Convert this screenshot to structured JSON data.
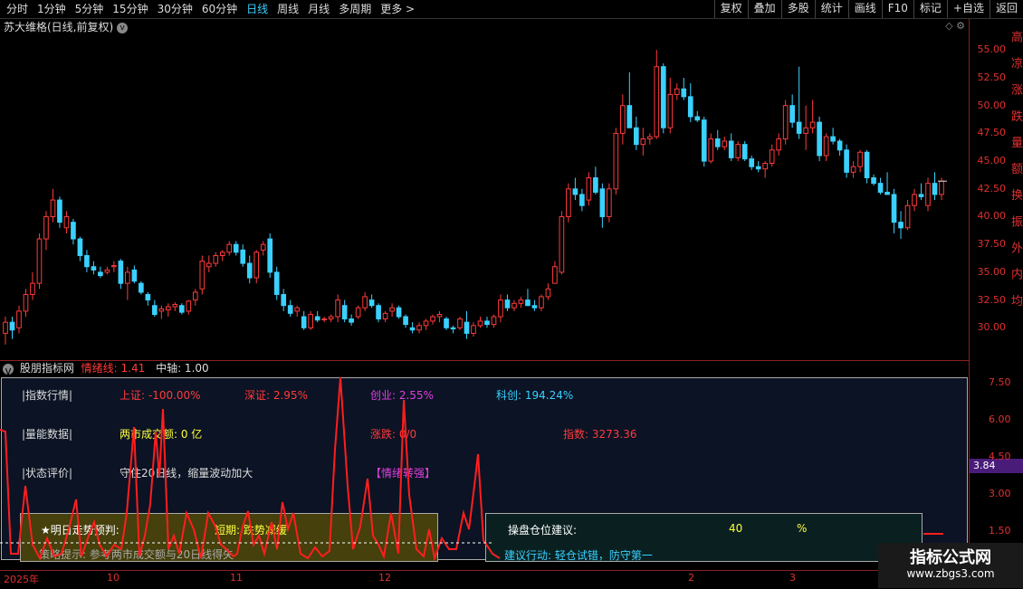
{
  "toolbar": {
    "periods": [
      "分时",
      "1分钟",
      "5分钟",
      "15分钟",
      "30分钟",
      "60分钟",
      "日线",
      "周线",
      "月线",
      "多周期",
      "更多 >"
    ],
    "active_index": 6,
    "right_buttons": [
      "复权",
      "叠加",
      "多股",
      "统计",
      "画线",
      "F10",
      "标记",
      "+自选",
      "返回"
    ]
  },
  "stock": {
    "title": "苏大维格(日线,前复权)",
    "chevron": "v",
    "right_icons": "◇ ⚙"
  },
  "price_axis": [
    "55.00",
    "52.50",
    "50.00",
    "47.50",
    "45.00",
    "42.50",
    "40.00",
    "37.50",
    "35.00",
    "32.50",
    "30.00"
  ],
  "right_strip_text": "高 凉 涨 跌 量 额 换 振 外 内 均",
  "indicator": {
    "name": "股朋指标网",
    "line_label": "情绪线: 1.41",
    "axis_label": "中轴: 1.00"
  },
  "info": {
    "row1_label": "|指数行情|",
    "sh": "上证: -100.00%",
    "sz": "深证: 2.95%",
    "cyb": "创业: 2.55%",
    "kc": "科创: 194.24%",
    "row2_label": "|量能数据|",
    "turnover": "两市成交额: 0 亿",
    "updown": "涨跌: 0/0",
    "index": "指数: 3273.36",
    "row3_label": "|状态评价|",
    "status": "守住20日线，缩量波动加大",
    "mood": "【情绪转强】",
    "forecast_label": "★明日走势预判:",
    "forecast_value": "短期: 跌势减缓",
    "tip": "策略提示: 参考两市成交额与20日线得失",
    "position_label": "操盘仓位建议:",
    "position_value": "40",
    "position_unit": "%",
    "action": "建议行动: 轻仓试错，防守第一"
  },
  "sub_axis": [
    "7.50",
    "6.00",
    "4.50",
    "3.00",
    "1.50"
  ],
  "sub_badge": "3.84",
  "date_axis": [
    "2025年",
    "10",
    "11",
    "12",
    "2",
    "3"
  ],
  "watermark": {
    "line1": "指标公式网",
    "line2": "www.zbgs3.com"
  },
  "colors": {
    "up": "#ff3b3b",
    "down": "#3ad1ff",
    "line": "#ff1e1e"
  },
  "chart_data": {
    "type": "candlestick",
    "title": "苏大维格(日线,前复权)",
    "ylim": [
      27.5,
      56.0
    ],
    "candles": [
      [
        29.5,
        31.0,
        28.5,
        30.5
      ],
      [
        30.5,
        31.0,
        29.0,
        29.8
      ],
      [
        30.0,
        32.0,
        29.5,
        31.5
      ],
      [
        31.5,
        33.5,
        31.0,
        33.0
      ],
      [
        33.0,
        35.0,
        32.5,
        34.0
      ],
      [
        34.0,
        38.5,
        33.5,
        38.0
      ],
      [
        38.0,
        40.5,
        37.0,
        40.0
      ],
      [
        40.0,
        42.5,
        39.5,
        41.5
      ],
      [
        41.5,
        41.8,
        39.0,
        39.5
      ],
      [
        39.0,
        40.5,
        38.5,
        40.0
      ],
      [
        39.5,
        39.8,
        37.5,
        38.0
      ],
      [
        38.0,
        38.2,
        36.0,
        36.5
      ],
      [
        36.5,
        37.0,
        35.0,
        35.5
      ],
      [
        35.5,
        36.0,
        34.8,
        35.2
      ],
      [
        35.0,
        35.5,
        34.5,
        34.7
      ],
      [
        35.0,
        35.5,
        34.8,
        35.2
      ],
      [
        35.5,
        36.0,
        35.0,
        35.6
      ],
      [
        36.0,
        36.2,
        33.5,
        34.0
      ],
      [
        34.0,
        35.5,
        32.5,
        35.0
      ],
      [
        35.2,
        35.6,
        34.0,
        34.2
      ],
      [
        34.0,
        34.2,
        33.0,
        33.2
      ],
      [
        33.0,
        33.2,
        32.0,
        32.5
      ],
      [
        32.0,
        32.5,
        31.0,
        31.2
      ],
      [
        31.5,
        32.0,
        30.8,
        31.7
      ],
      [
        31.6,
        32.2,
        31.0,
        31.9
      ],
      [
        31.9,
        32.3,
        31.5,
        32.1
      ],
      [
        32.0,
        32.2,
        31.2,
        31.4
      ],
      [
        31.5,
        32.5,
        31.2,
        32.4
      ],
      [
        32.5,
        33.5,
        32.0,
        33.2
      ],
      [
        33.5,
        36.5,
        33.0,
        36.0
      ],
      [
        35.5,
        36.5,
        35.0,
        35.8
      ],
      [
        35.8,
        36.8,
        35.5,
        36.5
      ],
      [
        36.5,
        37.0,
        36.0,
        36.8
      ],
      [
        36.8,
        37.8,
        36.5,
        37.5
      ],
      [
        37.5,
        37.8,
        36.5,
        36.8
      ],
      [
        37.0,
        37.5,
        35.5,
        35.8
      ],
      [
        35.8,
        36.5,
        34.0,
        34.5
      ],
      [
        34.5,
        37.0,
        34.0,
        36.8
      ],
      [
        37.0,
        37.8,
        36.5,
        37.5
      ],
      [
        38.0,
        38.5,
        34.5,
        35.0
      ],
      [
        35.0,
        35.5,
        32.5,
        33.0
      ],
      [
        33.0,
        33.5,
        31.5,
        32.0
      ],
      [
        32.0,
        32.5,
        31.0,
        31.3
      ],
      [
        31.5,
        32.0,
        31.0,
        31.8
      ],
      [
        31.0,
        31.5,
        29.8,
        30.0
      ],
      [
        30.0,
        31.5,
        29.8,
        31.2
      ],
      [
        31.0,
        31.5,
        30.5,
        30.7
      ],
      [
        30.8,
        31.0,
        30.5,
        30.8
      ],
      [
        30.8,
        31.2,
        30.5,
        31.0
      ],
      [
        31.0,
        33.0,
        30.5,
        32.5
      ],
      [
        32.0,
        32.5,
        30.5,
        30.8
      ],
      [
        30.8,
        31.2,
        30.2,
        30.5
      ],
      [
        31.0,
        32.0,
        30.8,
        31.8
      ],
      [
        31.8,
        33.2,
        31.5,
        32.8
      ],
      [
        32.5,
        33.0,
        31.8,
        32.0
      ],
      [
        32.0,
        32.2,
        30.5,
        30.8
      ],
      [
        30.8,
        31.5,
        30.5,
        31.3
      ],
      [
        31.5,
        32.2,
        31.0,
        31.8
      ],
      [
        31.8,
        32.0,
        30.8,
        31.0
      ],
      [
        31.0,
        31.2,
        30.0,
        30.3
      ],
      [
        30.0,
        30.5,
        29.5,
        29.8
      ],
      [
        29.8,
        30.5,
        29.5,
        30.2
      ],
      [
        30.2,
        30.8,
        29.8,
        30.6
      ],
      [
        30.6,
        31.2,
        30.3,
        31.0
      ],
      [
        31.0,
        31.5,
        30.5,
        31.2
      ],
      [
        30.8,
        31.0,
        29.8,
        30.0
      ],
      [
        30.0,
        30.2,
        29.5,
        29.9
      ],
      [
        30.0,
        31.0,
        29.8,
        30.8
      ],
      [
        30.5,
        31.5,
        29.0,
        29.5
      ],
      [
        29.5,
        30.5,
        29.2,
        30.2
      ],
      [
        30.2,
        31.0,
        30.0,
        30.6
      ],
      [
        30.6,
        31.0,
        30.0,
        30.3
      ],
      [
        30.3,
        31.2,
        30.0,
        31.0
      ],
      [
        31.0,
        33.0,
        30.5,
        32.5
      ],
      [
        32.5,
        33.0,
        31.5,
        31.8
      ],
      [
        31.8,
        32.5,
        31.5,
        32.2
      ],
      [
        32.2,
        32.8,
        31.8,
        32.5
      ],
      [
        32.5,
        33.5,
        32.0,
        32.0
      ],
      [
        32.0,
        32.5,
        31.5,
        31.8
      ],
      [
        31.8,
        33.0,
        31.5,
        32.8
      ],
      [
        32.8,
        34.0,
        32.5,
        33.5
      ],
      [
        34.0,
        36.0,
        35.0,
        35.5
      ],
      [
        35.0,
        40.5,
        34.8,
        40.0
      ],
      [
        40.0,
        43.0,
        39.5,
        42.5
      ],
      [
        42.5,
        43.5,
        41.5,
        42.0
      ],
      [
        42.0,
        42.5,
        40.5,
        41.0
      ],
      [
        41.5,
        44.0,
        41.0,
        43.5
      ],
      [
        43.5,
        44.5,
        42.0,
        42.2
      ],
      [
        42.5,
        43.0,
        39.0,
        40.0
      ],
      [
        40.0,
        43.0,
        39.5,
        42.5
      ],
      [
        42.5,
        48.0,
        42.0,
        47.5
      ],
      [
        47.5,
        51.0,
        46.5,
        50.0
      ],
      [
        50.0,
        53.0,
        48.5,
        48.0
      ],
      [
        48.0,
        49.0,
        46.0,
        46.5
      ],
      [
        46.5,
        48.0,
        45.5,
        47.0
      ],
      [
        47.0,
        47.5,
        46.5,
        47.2
      ],
      [
        47.2,
        55.0,
        47.0,
        53.5
      ],
      [
        53.5,
        53.8,
        47.5,
        48.0
      ],
      [
        48.0,
        52.5,
        47.5,
        51.0
      ],
      [
        51.0,
        52.0,
        50.5,
        51.5
      ],
      [
        51.5,
        52.5,
        50.5,
        50.8
      ],
      [
        50.8,
        52.0,
        48.5,
        49.0
      ],
      [
        49.0,
        49.5,
        48.5,
        48.7
      ],
      [
        48.7,
        49.0,
        44.5,
        45.0
      ],
      [
        45.0,
        47.5,
        44.8,
        47.0
      ],
      [
        47.0,
        47.8,
        46.0,
        46.3
      ],
      [
        46.3,
        47.2,
        46.0,
        46.8
      ],
      [
        46.8,
        47.5,
        45.0,
        45.3
      ],
      [
        45.3,
        46.8,
        45.0,
        46.5
      ],
      [
        46.5,
        46.8,
        45.0,
        45.2
      ],
      [
        45.2,
        45.5,
        44.2,
        44.5
      ],
      [
        44.5,
        45.0,
        44.0,
        44.3
      ],
      [
        44.3,
        45.0,
        43.5,
        44.8
      ],
      [
        44.8,
        46.5,
        44.5,
        46.0
      ],
      [
        46.0,
        47.5,
        45.5,
        47.0
      ],
      [
        47.0,
        50.5,
        46.5,
        50.0
      ],
      [
        50.0,
        51.0,
        48.0,
        48.5
      ],
      [
        48.5,
        53.5,
        47.0,
        47.5
      ],
      [
        47.5,
        50.0,
        46.0,
        48.0
      ],
      [
        48.0,
        50.5,
        47.5,
        48.5
      ],
      [
        48.5,
        49.0,
        45.0,
        45.5
      ],
      [
        45.5,
        47.5,
        45.0,
        47.2
      ],
      [
        47.2,
        48.0,
        46.5,
        46.8
      ],
      [
        46.8,
        47.0,
        45.5,
        46.0
      ],
      [
        46.0,
        46.5,
        43.5,
        44.0
      ],
      [
        44.0,
        45.0,
        43.5,
        44.5
      ],
      [
        44.5,
        46.0,
        44.0,
        45.8
      ],
      [
        45.8,
        46.0,
        43.0,
        43.5
      ],
      [
        43.5,
        43.8,
        42.8,
        43.0
      ],
      [
        43.0,
        43.5,
        42.0,
        42.2
      ],
      [
        42.2,
        44.0,
        42.0,
        42.0
      ],
      [
        42.0,
        42.5,
        38.5,
        39.5
      ],
      [
        39.5,
        40.5,
        38.0,
        39.0
      ],
      [
        39.0,
        41.5,
        38.8,
        41.0
      ],
      [
        41.0,
        42.5,
        40.5,
        42.0
      ],
      [
        42.0,
        43.0,
        41.5,
        41.8
      ],
      [
        41.0,
        43.5,
        40.5,
        43.0
      ],
      [
        43.0,
        44.0,
        41.5,
        42.0
      ],
      [
        42.0,
        43.5,
        41.5,
        43.2
      ]
    ]
  }
}
